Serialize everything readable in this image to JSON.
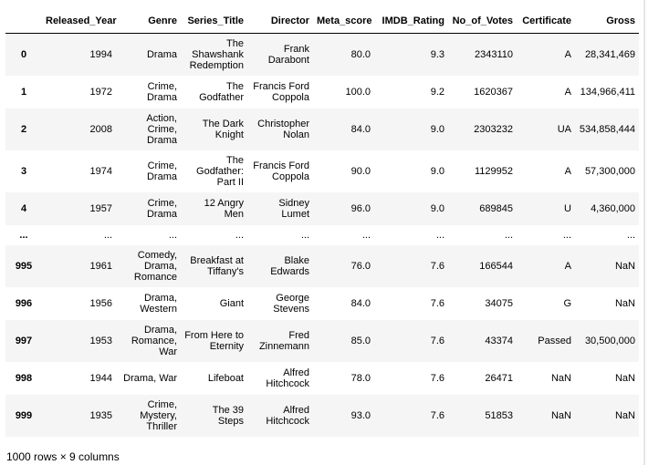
{
  "columns": [
    "",
    "Released_Year",
    "Genre",
    "Series_Title",
    "Director",
    "Meta_score",
    "IMDB_Rating",
    "No_of_Votes",
    "Certificate",
    "Gross"
  ],
  "rows": [
    {
      "index": "0",
      "cells": [
        "1994",
        "Drama",
        "The Shawshank Redemption",
        "Frank Darabont",
        "80.0",
        "9.3",
        "2343110",
        "A",
        "28,341,469"
      ]
    },
    {
      "index": "1",
      "cells": [
        "1972",
        "Crime, Drama",
        "The Godfather",
        "Francis Ford Coppola",
        "100.0",
        "9.2",
        "1620367",
        "A",
        "134,966,411"
      ]
    },
    {
      "index": "2",
      "cells": [
        "2008",
        "Action, Crime, Drama",
        "The Dark Knight",
        "Christopher Nolan",
        "84.0",
        "9.0",
        "2303232",
        "UA",
        "534,858,444"
      ]
    },
    {
      "index": "3",
      "cells": [
        "1974",
        "Crime, Drama",
        "The Godfather: Part II",
        "Francis Ford Coppola",
        "90.0",
        "9.0",
        "1129952",
        "A",
        "57,300,000"
      ]
    },
    {
      "index": "4",
      "cells": [
        "1957",
        "Crime, Drama",
        "12 Angry Men",
        "Sidney Lumet",
        "96.0",
        "9.0",
        "689845",
        "U",
        "4,360,000"
      ]
    },
    {
      "index": "...",
      "cells": [
        "...",
        "...",
        "...",
        "...",
        "...",
        "...",
        "...",
        "...",
        "..."
      ]
    },
    {
      "index": "995",
      "cells": [
        "1961",
        "Comedy, Drama, Romance",
        "Breakfast at Tiffany's",
        "Blake Edwards",
        "76.0",
        "7.6",
        "166544",
        "A",
        "NaN"
      ]
    },
    {
      "index": "996",
      "cells": [
        "1956",
        "Drama, Western",
        "Giant",
        "George Stevens",
        "84.0",
        "7.6",
        "34075",
        "G",
        "NaN"
      ]
    },
    {
      "index": "997",
      "cells": [
        "1953",
        "Drama, Romance, War",
        "From Here to Eternity",
        "Fred Zinnemann",
        "85.0",
        "7.6",
        "43374",
        "Passed",
        "30,500,000"
      ]
    },
    {
      "index": "998",
      "cells": [
        "1944",
        "Drama, War",
        "Lifeboat",
        "Alfred Hitchcock",
        "78.0",
        "7.6",
        "26471",
        "NaN",
        "NaN"
      ]
    },
    {
      "index": "999",
      "cells": [
        "1935",
        "Crime, Mystery, Thriller",
        "The 39 Steps",
        "Alfred Hitchcock",
        "93.0",
        "7.6",
        "51853",
        "NaN",
        "NaN"
      ]
    }
  ],
  "footer": "1000 rows × 9 columns"
}
